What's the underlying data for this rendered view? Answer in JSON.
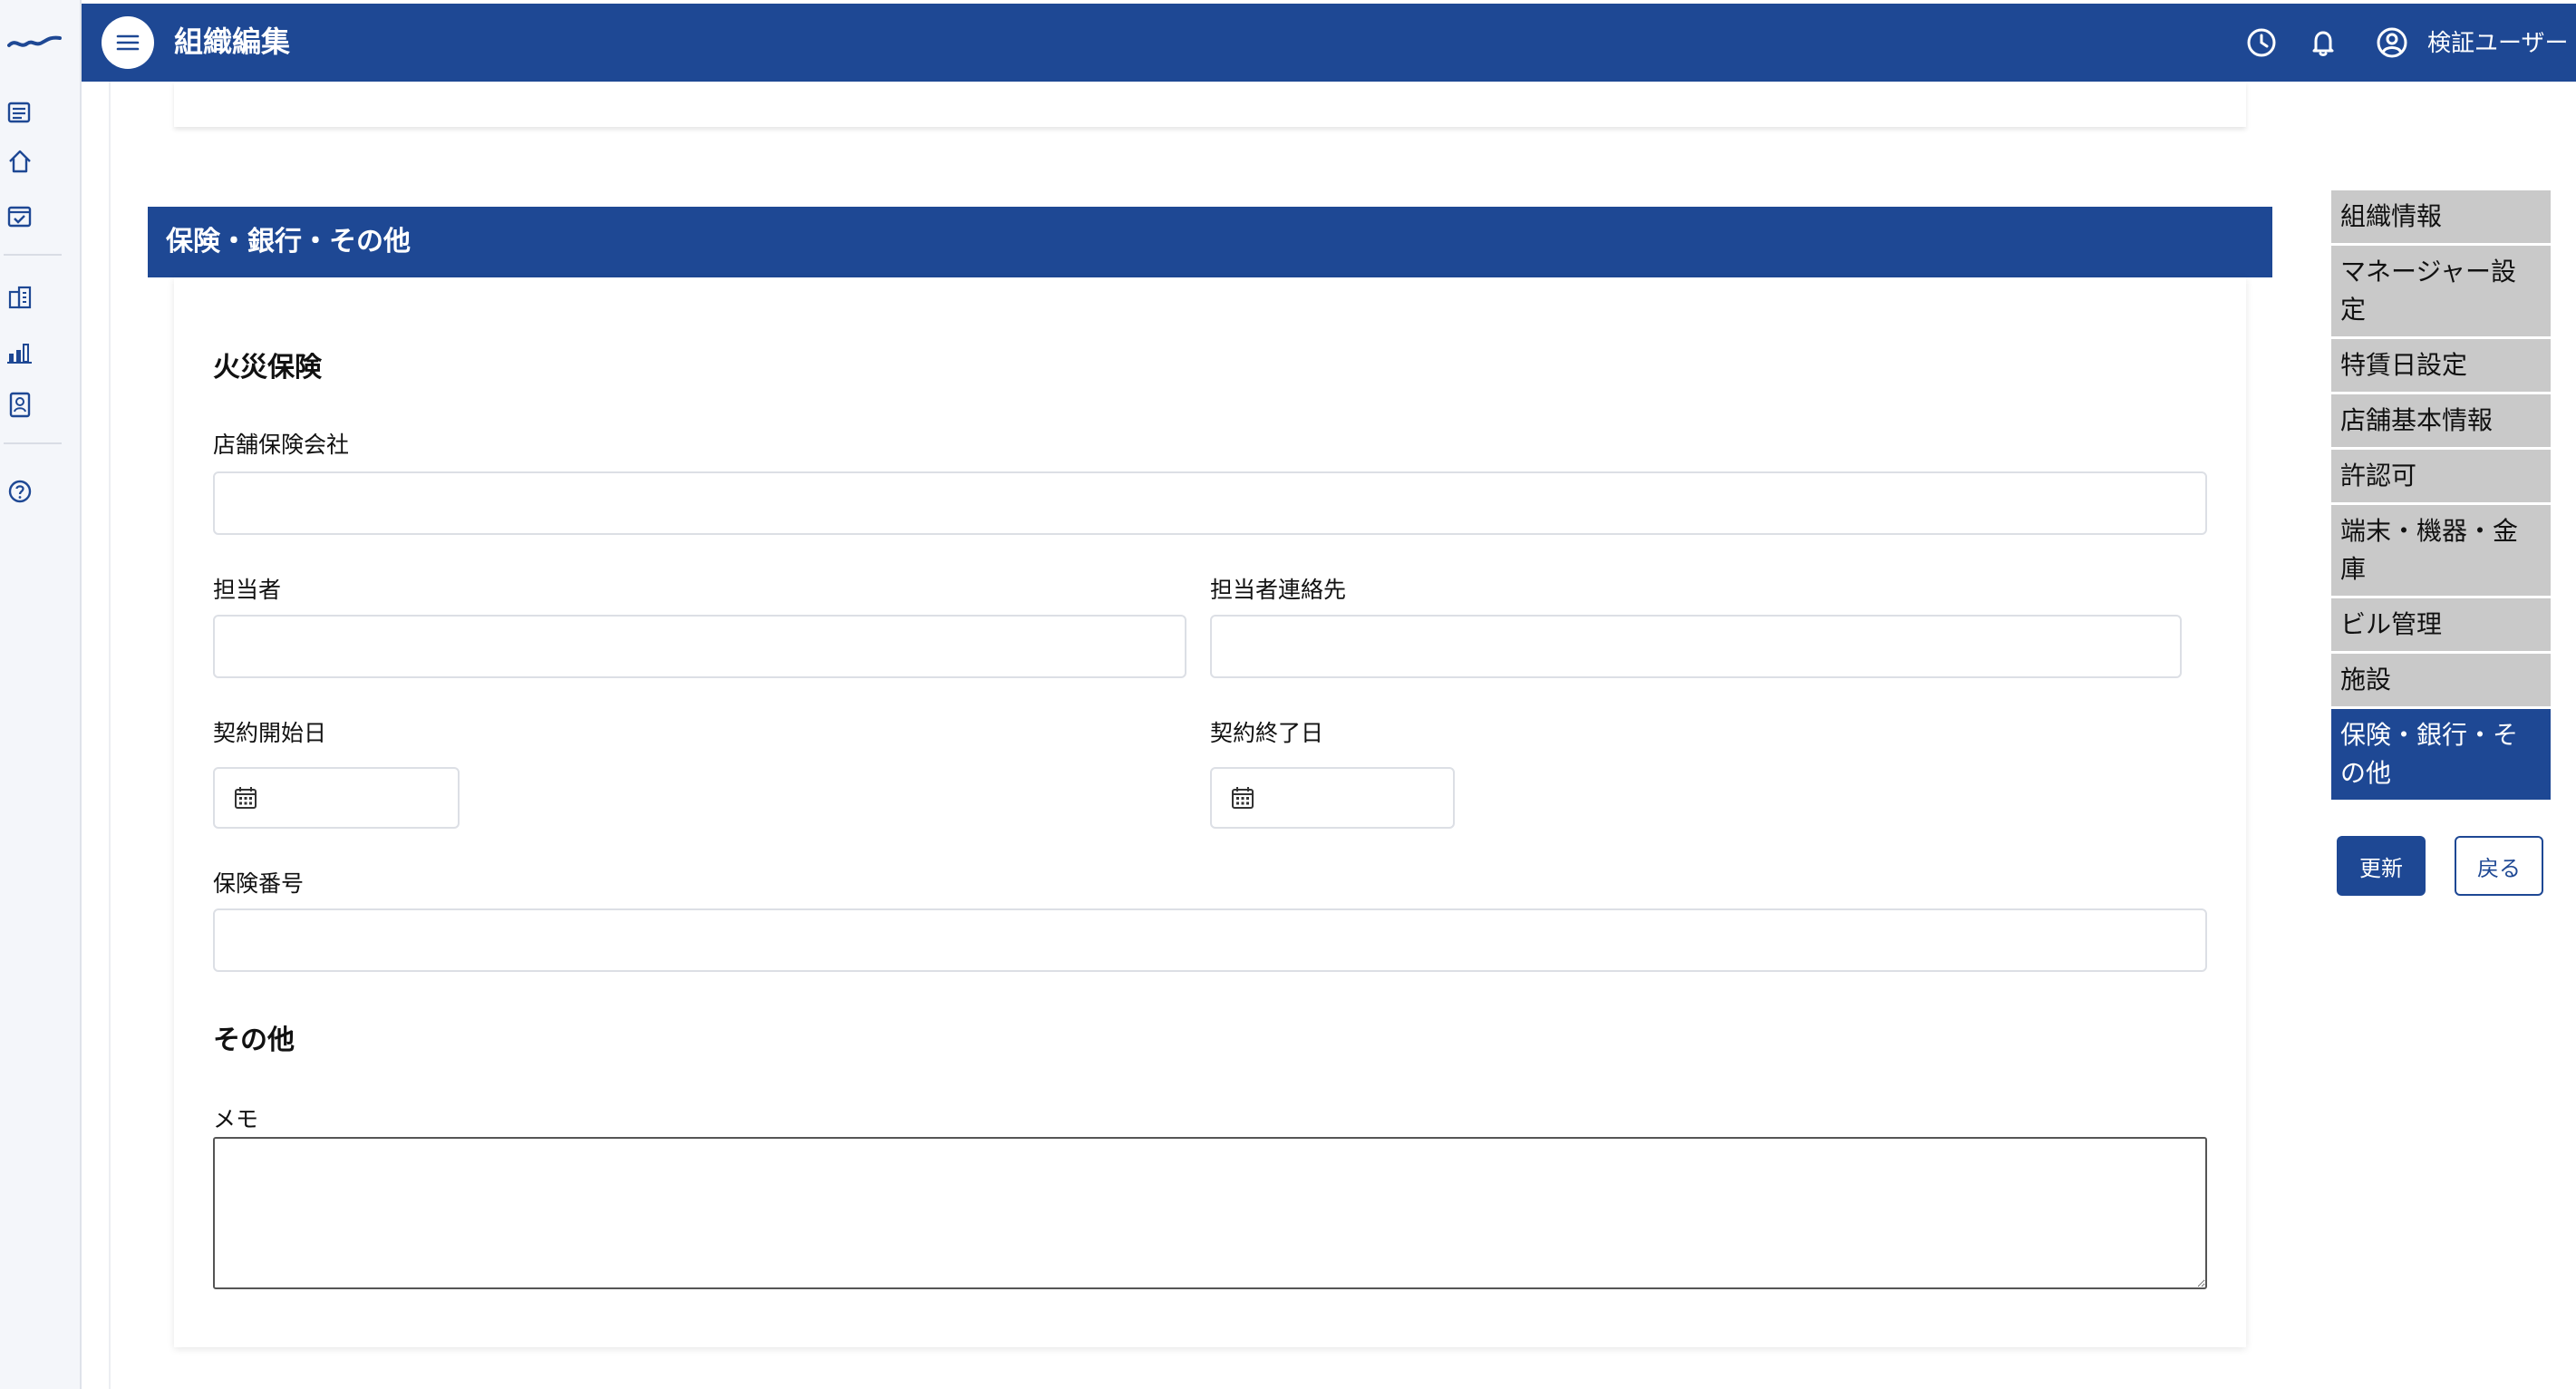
{
  "header": {
    "title": "組織編集",
    "user_name": "検証ユーザー"
  },
  "section": {
    "title": "保険・銀行・その他"
  },
  "fire_insurance": {
    "heading": "火災保険",
    "company_label": "店舗保険会社",
    "company_value": "",
    "contact_person_label": "担当者",
    "contact_person_value": "",
    "contact_info_label": "担当者連絡先",
    "contact_info_value": "",
    "start_date_label": "契約開始日",
    "end_date_label": "契約終了日",
    "policy_number_label": "保険番号",
    "policy_number_value": ""
  },
  "other": {
    "heading": "その他",
    "memo_label": "メモ",
    "memo_value": ""
  },
  "side_nav": {
    "items": [
      {
        "label": "組織情報",
        "active": false
      },
      {
        "label": "マネージャー設定",
        "active": false
      },
      {
        "label": "特賃日設定",
        "active": false
      },
      {
        "label": "店舗基本情報",
        "active": false
      },
      {
        "label": "許認可",
        "active": false
      },
      {
        "label": "端末・機器・金庫",
        "active": false
      },
      {
        "label": "ビル管理",
        "active": false
      },
      {
        "label": "施設",
        "active": false
      },
      {
        "label": "保険・銀行・その他",
        "active": true
      }
    ]
  },
  "actions": {
    "update_label": "更新",
    "back_label": "戻る"
  },
  "colors": {
    "brand": "#1e4894",
    "nav_inactive": "#c9c9c9"
  },
  "icons": {
    "rail": [
      "logo-icon",
      "list-icon",
      "home-icon",
      "calendar-check-icon",
      "building-icon",
      "bar-chart-icon",
      "id-badge-icon",
      "help-icon"
    ],
    "header": [
      "menu-icon",
      "clock-icon",
      "bell-icon",
      "user-circle-icon"
    ]
  }
}
